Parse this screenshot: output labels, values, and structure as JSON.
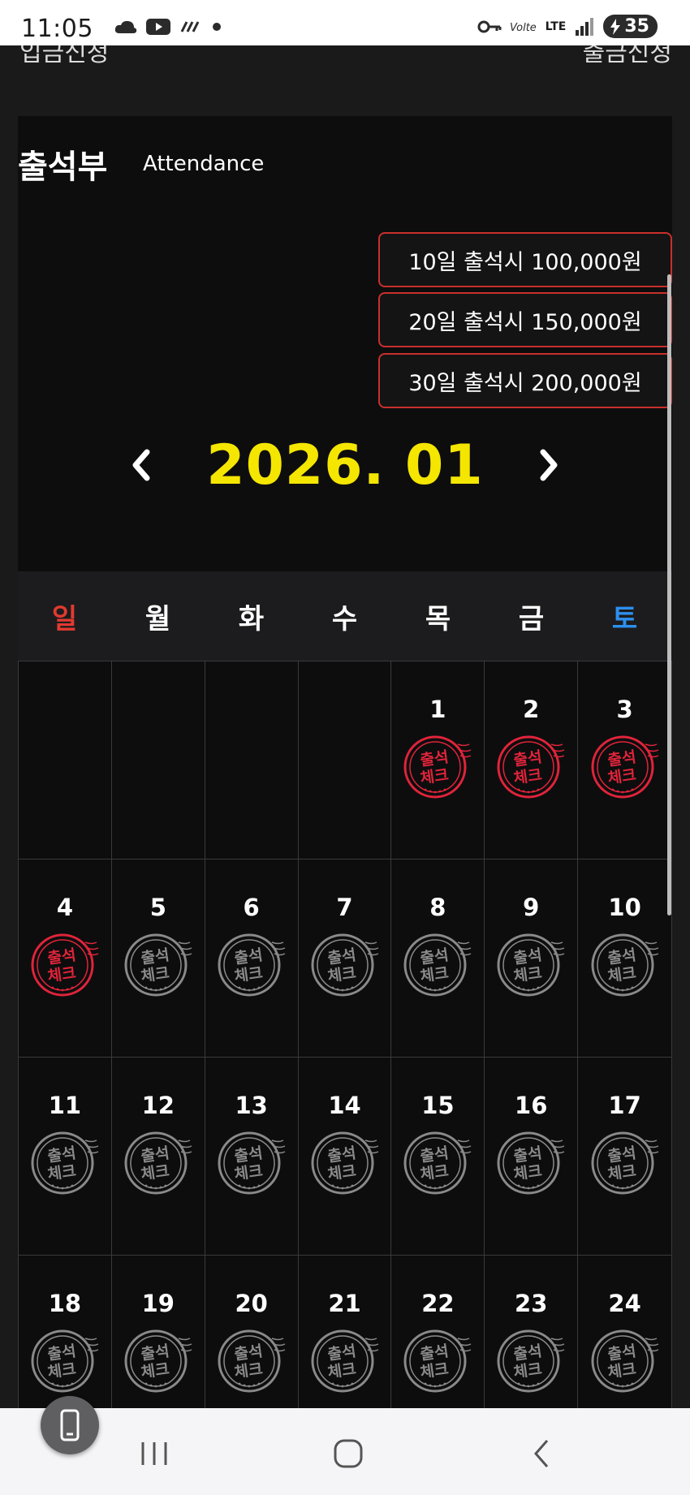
{
  "status_bar": {
    "time": "11:05",
    "battery": "35",
    "network": "LTE"
  },
  "top_links": {
    "left": "입금신청",
    "right": "출금신청"
  },
  "attendance": {
    "title": "출석부",
    "subtitle": "Attendance",
    "rewards": [
      {
        "label": "10일 출석시 100,000원"
      },
      {
        "label": "20일 출석시 150,000원"
      },
      {
        "label": "30일 출석시 200,000원"
      }
    ],
    "month": "2026. 01"
  },
  "weekdays": [
    "일",
    "월",
    "화",
    "수",
    "목",
    "금",
    "토"
  ],
  "stamp_text": {
    "line1": "출석",
    "line2": "체크"
  },
  "colors": {
    "accent_yellow": "#f5e600",
    "sunday_red": "#e23a2f",
    "saturday_blue": "#2d8ff0",
    "stamp_active": "#e0243a",
    "stamp_inactive": "#8a8a8a",
    "reward_border": "#c8302c"
  },
  "weeks": [
    [
      {
        "day": "",
        "stamped": null
      },
      {
        "day": "",
        "stamped": null
      },
      {
        "day": "",
        "stamped": null
      },
      {
        "day": "",
        "stamped": null
      },
      {
        "day": "1",
        "stamped": true
      },
      {
        "day": "2",
        "stamped": true
      },
      {
        "day": "3",
        "stamped": true
      }
    ],
    [
      {
        "day": "4",
        "stamped": true
      },
      {
        "day": "5",
        "stamped": false
      },
      {
        "day": "6",
        "stamped": false
      },
      {
        "day": "7",
        "stamped": false
      },
      {
        "day": "8",
        "stamped": false
      },
      {
        "day": "9",
        "stamped": false
      },
      {
        "day": "10",
        "stamped": false
      }
    ],
    [
      {
        "day": "11",
        "stamped": false
      },
      {
        "day": "12",
        "stamped": false
      },
      {
        "day": "13",
        "stamped": false
      },
      {
        "day": "14",
        "stamped": false
      },
      {
        "day": "15",
        "stamped": false
      },
      {
        "day": "16",
        "stamped": false
      },
      {
        "day": "17",
        "stamped": false
      }
    ],
    [
      {
        "day": "18",
        "stamped": false
      },
      {
        "day": "19",
        "stamped": false
      },
      {
        "day": "20",
        "stamped": false
      },
      {
        "day": "21",
        "stamped": false
      },
      {
        "day": "22",
        "stamped": false
      },
      {
        "day": "23",
        "stamped": false
      },
      {
        "day": "24",
        "stamped": false
      }
    ]
  ]
}
